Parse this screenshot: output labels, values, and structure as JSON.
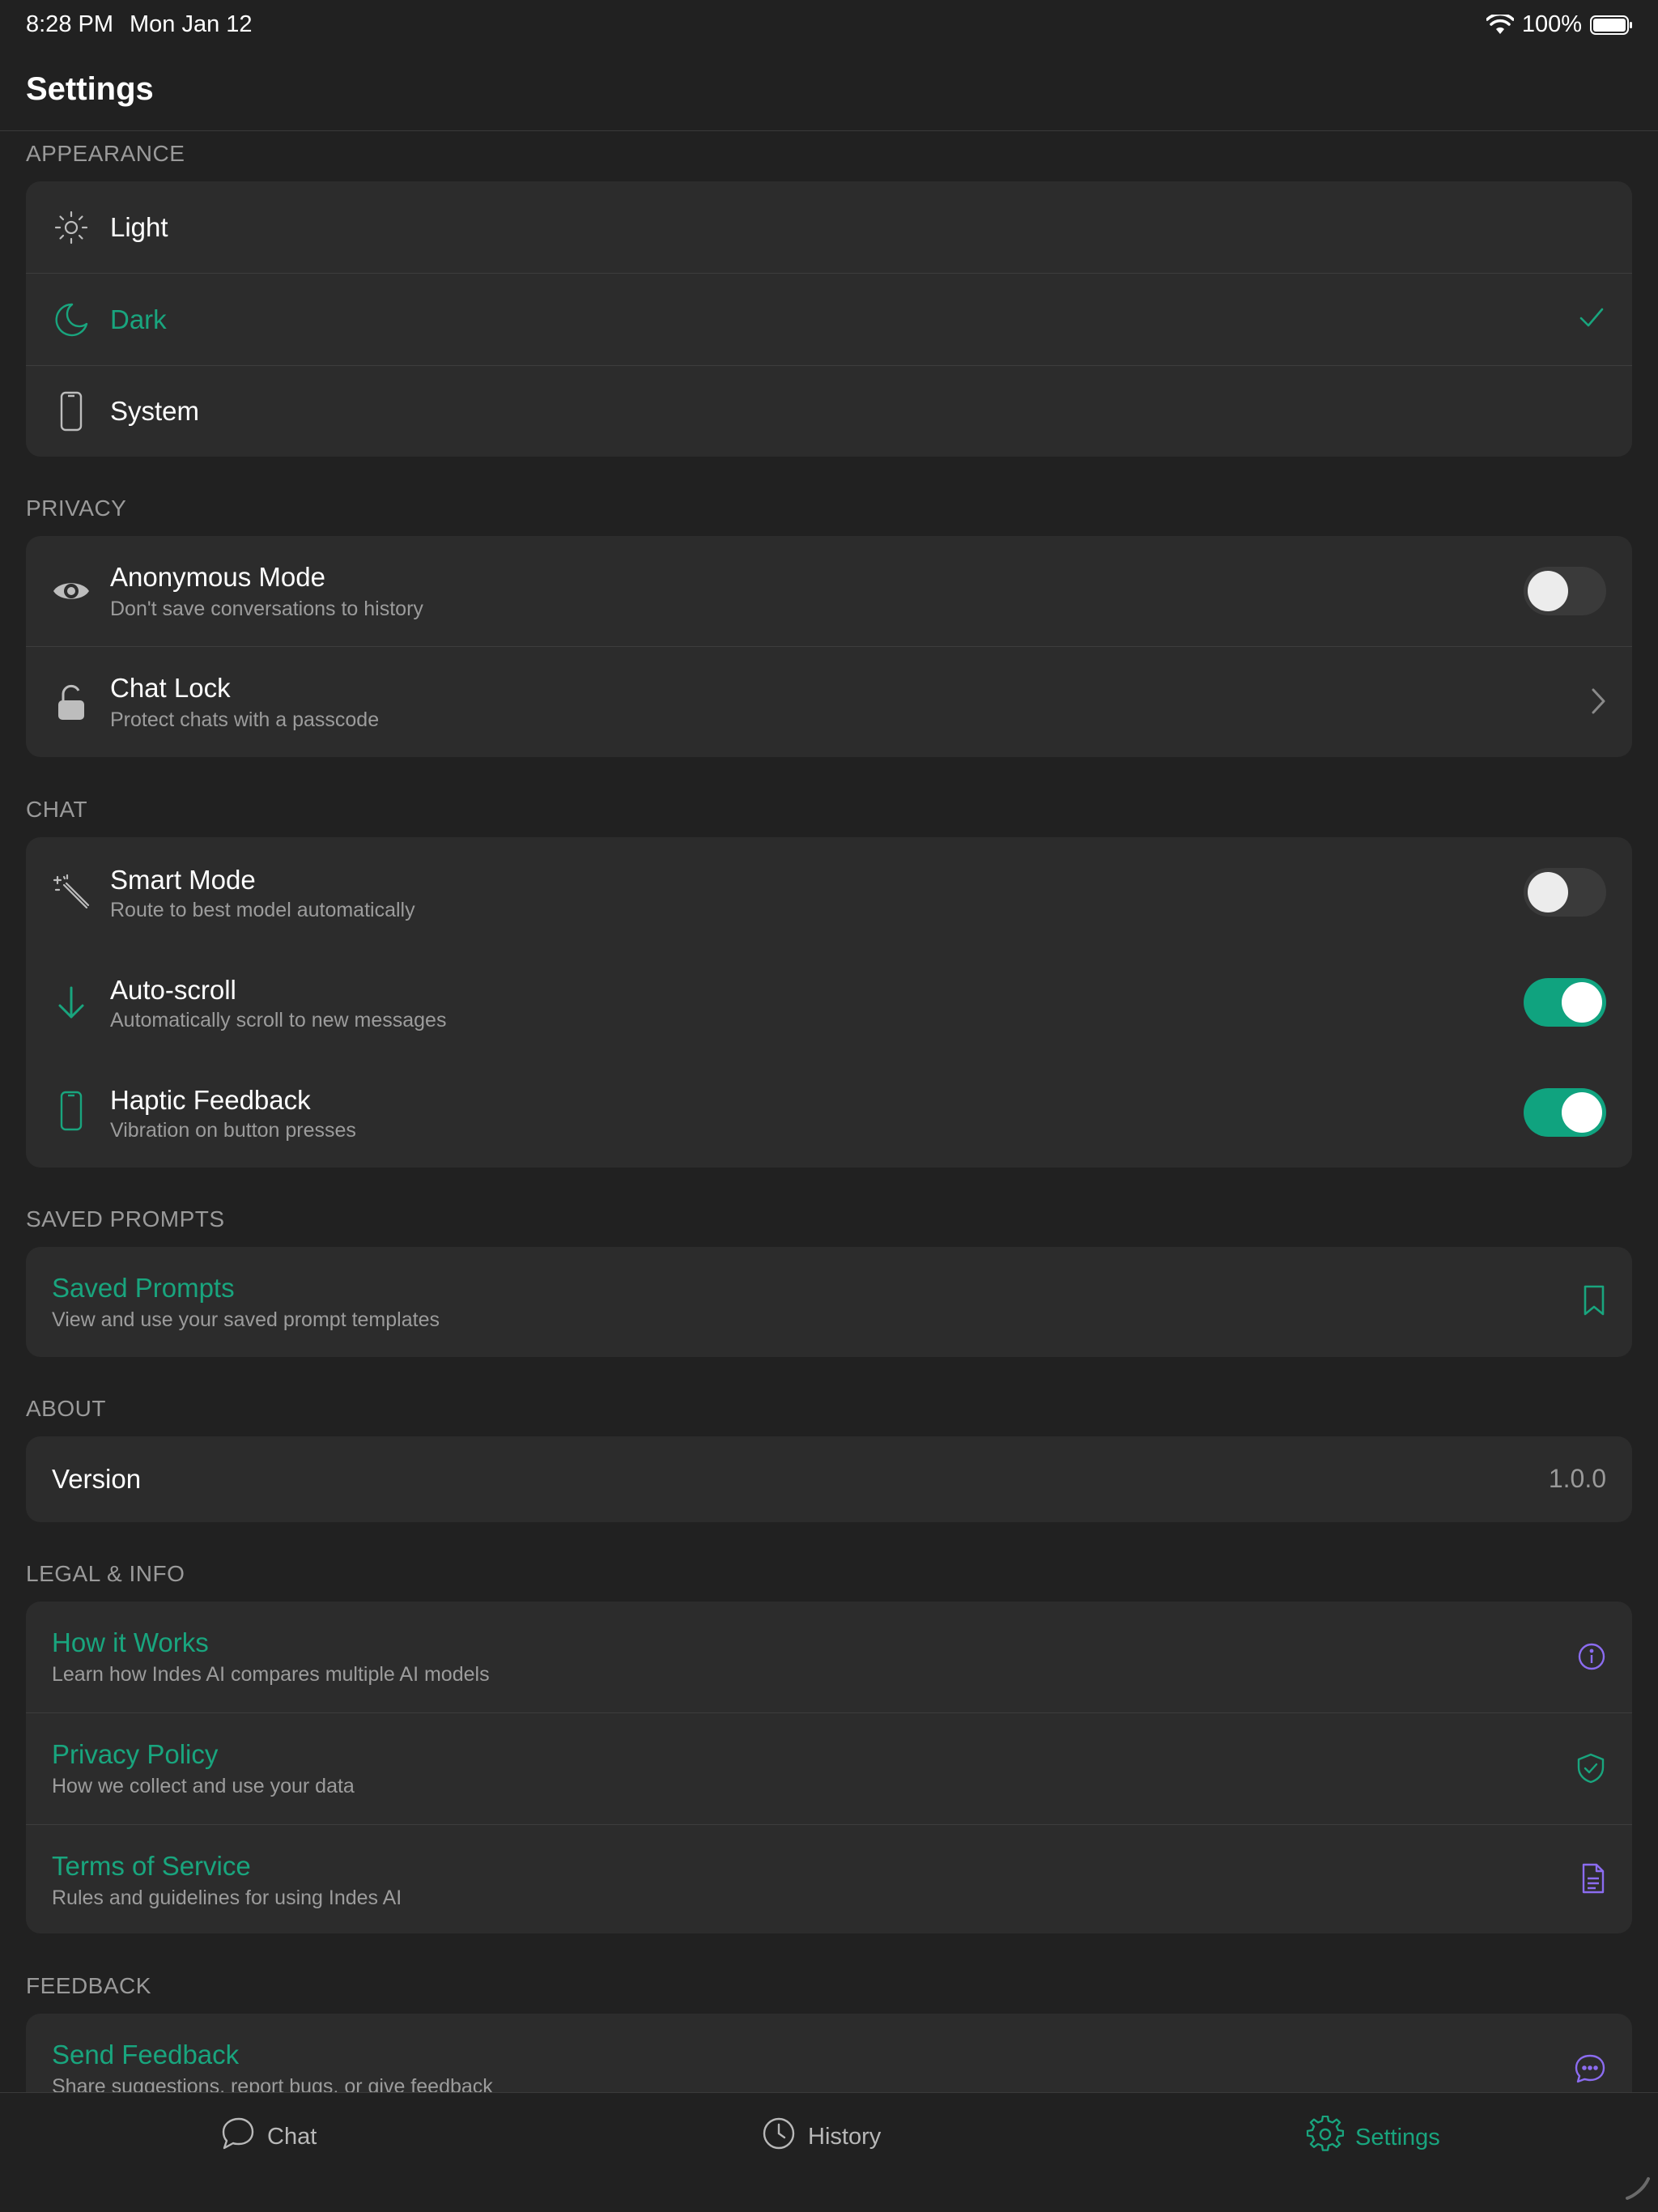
{
  "status": {
    "time": "8:28 PM",
    "date": "Mon Jan 12",
    "battery": "100%"
  },
  "header": {
    "title": "Settings"
  },
  "colors": {
    "accent": "#10a37f",
    "accent_text": "#19a57e",
    "purple": "#8b6cf0",
    "background": "#212121",
    "card": "#2c2c2c"
  },
  "sections": {
    "appearance": {
      "header": "APPEARANCE",
      "items": [
        {
          "label": "Light",
          "icon": "sun-icon"
        },
        {
          "label": "Dark",
          "icon": "moon-icon",
          "selected": true
        },
        {
          "label": "System",
          "icon": "phone-icon"
        }
      ]
    },
    "privacy": {
      "header": "PRIVACY",
      "items": [
        {
          "label": "Anonymous Mode",
          "sub": "Don't save conversations to history",
          "icon": "eye-icon",
          "toggle": false
        },
        {
          "label": "Chat Lock",
          "sub": "Protect chats with a passcode",
          "icon": "lock-icon"
        }
      ]
    },
    "chat": {
      "header": "CHAT",
      "items": [
        {
          "label": "Smart Mode",
          "sub": "Route to best model automatically",
          "icon": "magic-wand-icon",
          "toggle": false
        },
        {
          "label": "Auto-scroll",
          "sub": "Automatically scroll to new messages",
          "icon": "arrow-down-icon",
          "toggle": true
        },
        {
          "label": "Haptic Feedback",
          "sub": "Vibration on button presses",
          "icon": "phone-icon",
          "toggle": true
        }
      ]
    },
    "saved_prompts": {
      "header": "SAVED PROMPTS",
      "items": [
        {
          "label": "Saved Prompts",
          "sub": "View and use your saved prompt templates",
          "icon": "bookmark-icon"
        }
      ]
    },
    "about": {
      "header": "ABOUT",
      "items": [
        {
          "label": "Version",
          "value": "1.0.0"
        }
      ]
    },
    "legal": {
      "header": "LEGAL & INFO",
      "items": [
        {
          "label": "How it Works",
          "sub": "Learn how Indes AI compares multiple AI models",
          "icon": "info-icon"
        },
        {
          "label": "Privacy Policy",
          "sub": "How we collect and use your data",
          "icon": "shield-check-icon"
        },
        {
          "label": "Terms of Service",
          "sub": "Rules and guidelines for using Indes AI",
          "icon": "document-icon"
        }
      ]
    },
    "feedback": {
      "header": "FEEDBACK",
      "items": [
        {
          "label": "Send Feedback",
          "sub": "Share suggestions, report bugs, or give feedback",
          "icon": "chat-bubble-icon"
        }
      ]
    }
  },
  "tabbar": {
    "tabs": [
      {
        "label": "Chat",
        "icon": "chat-icon"
      },
      {
        "label": "History",
        "icon": "clock-icon"
      },
      {
        "label": "Settings",
        "icon": "gear-icon",
        "active": true
      }
    ]
  }
}
